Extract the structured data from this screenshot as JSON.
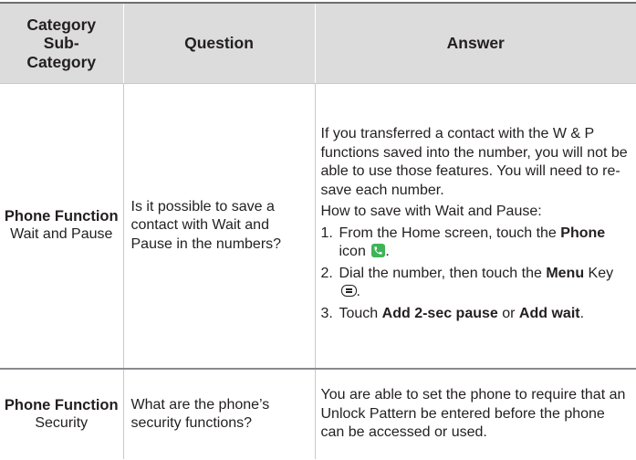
{
  "header": {
    "category_line1": "Category",
    "category_line2": "Sub-",
    "category_line3": "Category",
    "question": "Question",
    "answer": "Answer"
  },
  "rows": [
    {
      "category": "Phone Function",
      "subcategory": "Wait and Pause",
      "question": "Is it possible to save a contact with Wait and Pause in the numbers?",
      "answer_intro": "If you transferred a contact with the W & P functions saved into the number, you will not be able to use those features. You will need to re-save each number.",
      "answer_howto": "How to save with Wait and Pause:",
      "steps": [
        {
          "num": "1.",
          "pre": "From the Home screen, touch the ",
          "bold": "Phone",
          "post": " icon",
          "end": "."
        },
        {
          "num": "2.",
          "pre": "Dial the number, then touch the ",
          "bold": "Menu",
          "post": " Key",
          "end": "."
        },
        {
          "num": "3.",
          "pre": "Touch ",
          "bold": "Add 2-sec pause",
          "mid": " or ",
          "bold2": "Add wait",
          "end": "."
        }
      ]
    },
    {
      "category": "Phone Function",
      "subcategory": "Security",
      "question": "What are the phone’s security functions?",
      "answer": "You are able to set the phone to require that an Unlock Pattern be entered before the phone can be accessed or used."
    }
  ],
  "icons": {
    "phone_icon": "phone-icon",
    "menu_key_icon": "menu-key-icon"
  },
  "colors": {
    "header_bg": "#dcdcdd",
    "phone_icon_bg": "#3fb457",
    "text": "#231f20"
  }
}
